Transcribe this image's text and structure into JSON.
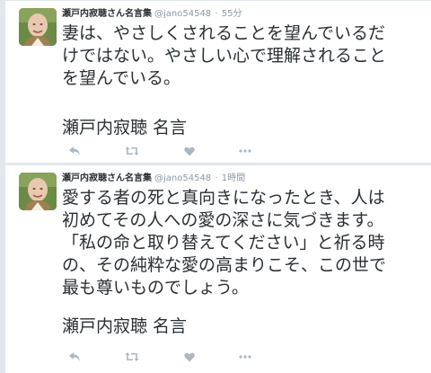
{
  "colors": {
    "page_background": "#e1e8ed",
    "card_background": "#ffffff",
    "text": "#292f33",
    "secondary_text": "#8899a6",
    "icon": "#aab8c2"
  },
  "tweets": [
    {
      "fullname": "瀬戸内寂聴さん名言集",
      "username": "@jano54548",
      "separator": "·",
      "timestamp": "55分",
      "text": "妻は、やさしくされることを望んでいるだ\nけではない。やさしい心で理解されること\nを望んでいる。",
      "signature": "瀬戸内寂聴 名言",
      "actions": [
        "reply-icon",
        "retweet-icon",
        "like-icon",
        "more-icon"
      ]
    },
    {
      "fullname": "瀬戸内寂聴さん名言集",
      "username": "@jano54548",
      "separator": "·",
      "timestamp": "1時間",
      "text": "愛する者の死と真向きになったとき、人は\n初めてその人への愛の深さに気づきます。\n「私の命と取り替えてください」と祈る時\nの、その純粋な愛の高まりこそ、この世で\n最も尊いものでしょう。",
      "signature": "瀬戸内寂聴 名言",
      "actions": [
        "reply-icon",
        "retweet-icon",
        "like-icon",
        "more-icon"
      ]
    }
  ]
}
